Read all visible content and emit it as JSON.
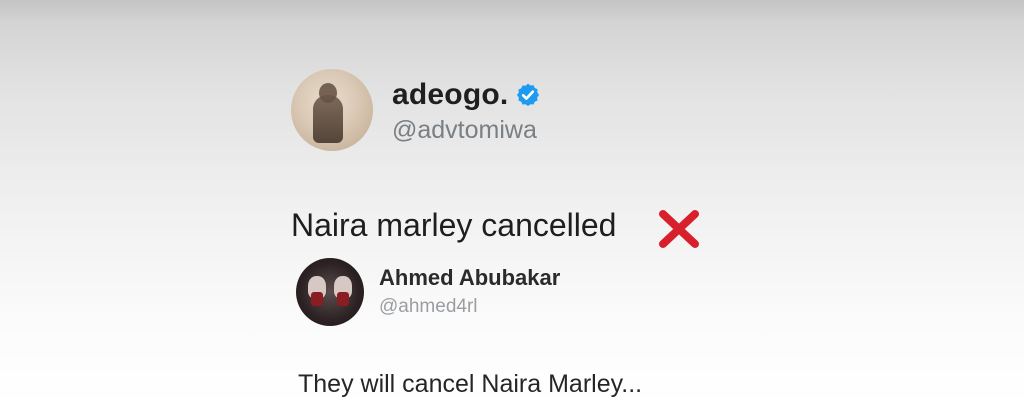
{
  "main_tweet": {
    "display_name": "adeogo.",
    "handle": "@advtomiwa",
    "text": "Naira marley cancelled",
    "verified_icon": "verified-badge-icon",
    "reaction_icon": "red-cross-mark-icon"
  },
  "quoted_tweet": {
    "display_name": "Ahmed Abubakar",
    "handle": "@ahmed4rl",
    "text": "They will cancel Naira Marley..."
  },
  "colors": {
    "verified_blue": "#1d9bf0",
    "cross_red": "#d8202c",
    "handle_gray": "#7a7f84"
  }
}
